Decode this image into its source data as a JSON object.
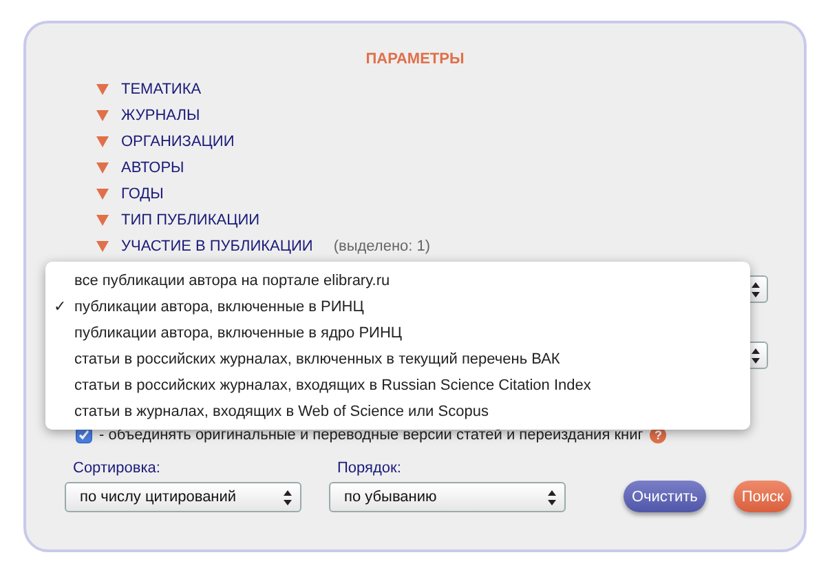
{
  "title": "ПАРАМЕТРЫ",
  "sections": [
    {
      "label": "ТЕМАТИКА"
    },
    {
      "label": "ЖУРНАЛЫ"
    },
    {
      "label": "ОРГАНИЗАЦИИ"
    },
    {
      "label": "АВТОРЫ"
    },
    {
      "label": "ГОДЫ"
    },
    {
      "label": "ТИП ПУБЛИКАЦИИ"
    },
    {
      "label": "УЧАСТИЕ В ПУБЛИКАЦИИ",
      "note": "(выделено: 1)"
    }
  ],
  "scope_menu": {
    "check_mark": "✓",
    "options": [
      {
        "label": "все публикации автора на портале elibrary.ru",
        "selected": false
      },
      {
        "label": "публикации автора, включенные в РИНЦ",
        "selected": true
      },
      {
        "label": "публикации автора, включенные в ядро РИНЦ",
        "selected": false
      },
      {
        "label": "статьи в российских журналах, включенных в текущий перечень ВАК",
        "selected": false
      },
      {
        "label": "статьи в российских журналах, входящих в Russian Science Citation Index",
        "selected": false
      },
      {
        "label": "статьи в журналах, входящих в Web of Science или Scopus",
        "selected": false
      }
    ]
  },
  "merge_option": {
    "checked": true,
    "label": "- объединять оригинальные и переводные версии статей и переиздания книг",
    "help": "?"
  },
  "sort": {
    "label": "Сортировка:",
    "value": "по числу цитирований"
  },
  "order": {
    "label": "Порядок:",
    "value": "по убыванию"
  },
  "buttons": [
    {
      "kind": "clear",
      "label": "Очистить"
    },
    {
      "kind": "search",
      "label": "Поиск"
    }
  ]
}
